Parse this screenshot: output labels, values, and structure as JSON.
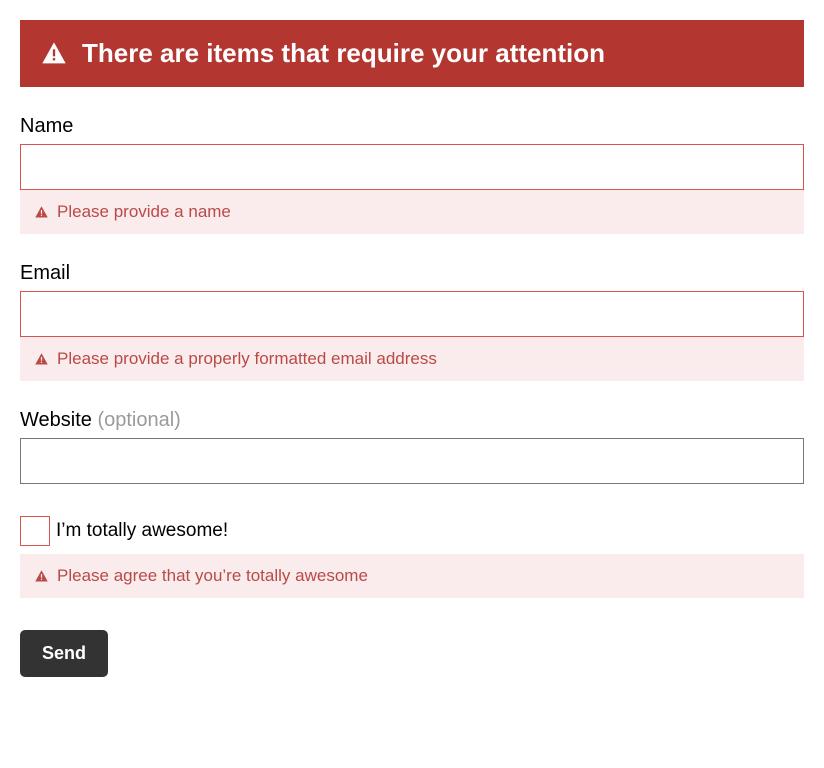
{
  "alert": {
    "heading": "There are items that require your attention"
  },
  "form": {
    "name": {
      "label": "Name",
      "value": "",
      "error": "Please provide a name"
    },
    "email": {
      "label": "Email",
      "value": "",
      "error": "Please provide a properly formatted email address"
    },
    "website": {
      "label": "Website",
      "optional_text": "(optional)",
      "value": ""
    },
    "awesome": {
      "label": "I’m totally awesome!",
      "checked": false,
      "error": "Please agree that you’re totally awesome"
    },
    "submit_label": "Send"
  },
  "colors": {
    "error_red": "#b33630",
    "error_bg": "#faecec",
    "error_text": "#b94a48"
  }
}
